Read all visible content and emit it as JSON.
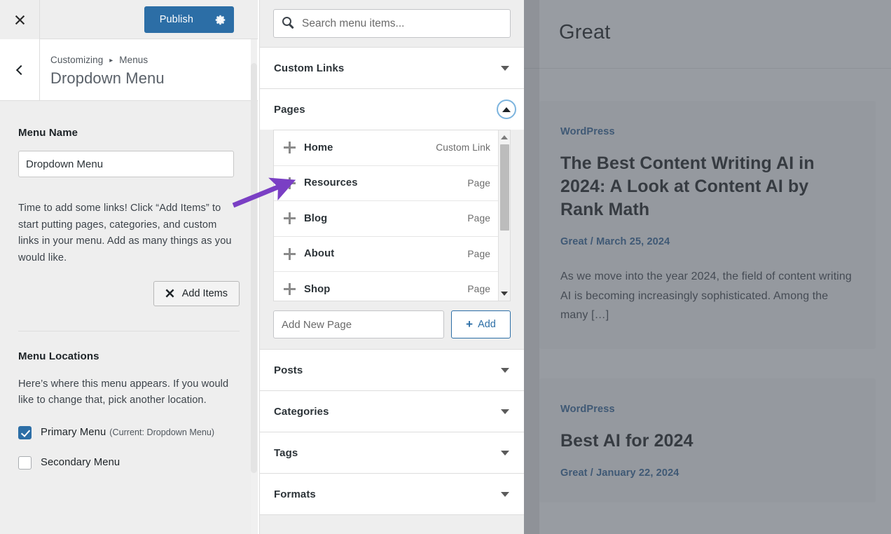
{
  "customizer": {
    "close_icon": "close-icon",
    "publish_label": "Publish",
    "gear_icon": "gear-icon",
    "back_icon": "chevron-left-icon",
    "breadcrumb_root": "Customizing",
    "breadcrumb_sep": "▸",
    "breadcrumb_section": "Menus",
    "panel_title": "Dropdown Menu",
    "menu_name": {
      "label": "Menu Name",
      "value": "Dropdown Menu"
    },
    "help_text": "Time to add some links! Click “Add Items” to start putting pages, categories, and custom links in your menu. Add as many things as you would like.",
    "add_items": {
      "label": "Add Items",
      "icon": "close-x-icon"
    },
    "menu_locations": {
      "label": "Menu Locations",
      "description": "Here’s where this menu appears. If you would like to change that, pick another location.",
      "options": [
        {
          "label": "Primary Menu",
          "current": "(Current: Dropdown Menu)",
          "checked": true
        },
        {
          "label": "Secondary Menu",
          "current": "",
          "checked": false
        }
      ]
    }
  },
  "add_panel": {
    "search": {
      "placeholder": "Search menu items...",
      "value": "",
      "icon": "search-icon"
    },
    "sections": [
      {
        "title": "Custom Links",
        "expanded": false,
        "icon": "chevron-down-icon"
      },
      {
        "title": "Pages",
        "expanded": true,
        "icon": "chevron-up-icon"
      },
      {
        "title": "Posts",
        "expanded": false,
        "icon": "chevron-down-icon"
      },
      {
        "title": "Categories",
        "expanded": false,
        "icon": "chevron-down-icon"
      },
      {
        "title": "Tags",
        "expanded": false,
        "icon": "chevron-down-icon"
      },
      {
        "title": "Formats",
        "expanded": false,
        "icon": "chevron-down-icon"
      }
    ],
    "pages_items": [
      {
        "name": "Home",
        "type": "Custom Link"
      },
      {
        "name": "Resources",
        "type": "Page"
      },
      {
        "name": "Blog",
        "type": "Page"
      },
      {
        "name": "About",
        "type": "Page"
      },
      {
        "name": "Shop",
        "type": "Page"
      }
    ],
    "add_new": {
      "placeholder": "Add New Page",
      "value": "",
      "button_label": "Add",
      "button_icon": "plus-icon"
    }
  },
  "preview": {
    "site_title": "Great",
    "posts": [
      {
        "category": "WordPress",
        "title": "The Best Content Writing AI in 2024: A Look at Content AI by Rank Math",
        "meta": "Great / March 25, 2024",
        "excerpt": "As we move into the year 2024, the field of content writing AI is becoming increasingly sophisticated. Among the many […]"
      },
      {
        "category": "WordPress",
        "title": "Best AI for 2024",
        "meta": "Great / January 22, 2024",
        "excerpt": ""
      }
    ]
  },
  "annotation": {
    "arrow_color": "#7a3fc4"
  },
  "colors": {
    "accent": "#2c6ea6",
    "panel_bg": "#eeeeee",
    "link": "#2d5f94",
    "arrow": "#7a3fc4"
  }
}
